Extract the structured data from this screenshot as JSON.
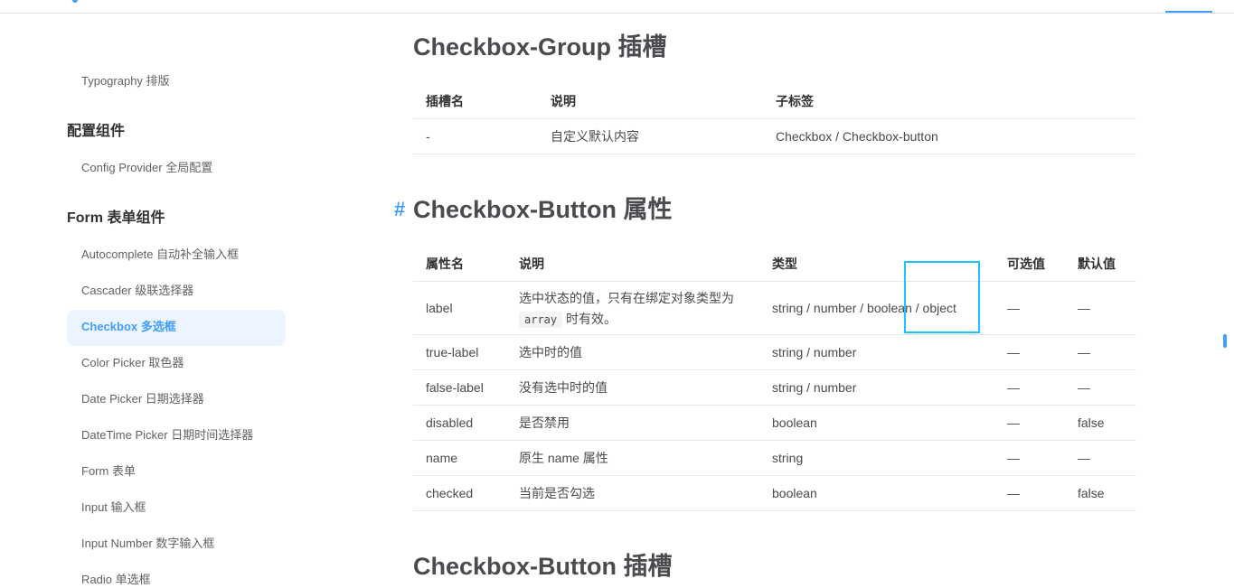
{
  "sidebar": {
    "items": [
      {
        "label": "Typography 排版"
      },
      {
        "group": "配置组件"
      },
      {
        "label": "Config Provider 全局配置"
      },
      {
        "group": "Form 表单组件"
      },
      {
        "label": "Autocomplete 自动补全输入框"
      },
      {
        "label": "Cascader 级联选择器"
      },
      {
        "label": "Checkbox 多选框",
        "active": true
      },
      {
        "label": "Color Picker 取色器"
      },
      {
        "label": "Date Picker 日期选择器"
      },
      {
        "label": "DateTime Picker 日期时间选择器"
      },
      {
        "label": "Form 表单"
      },
      {
        "label": "Input 输入框"
      },
      {
        "label": "Input Number 数字输入框"
      },
      {
        "label": "Radio 单选框"
      }
    ],
    "accent_color": "#409eff",
    "active_bg": "#ecf5ff"
  },
  "main": {
    "sections": [
      {
        "title": "Checkbox-Group 插槽",
        "headers": [
          "插槽名",
          "说明",
          "子标签"
        ],
        "rows": [
          [
            "-",
            "自定义默认内容",
            "Checkbox / Checkbox-button"
          ]
        ]
      },
      {
        "anchor": "#",
        "title": "Checkbox-Button 属性",
        "headers": [
          "属性名",
          "说明",
          "类型",
          "可选值",
          "默认值"
        ],
        "rows": [
          {
            "name": "label",
            "desc_line1": "选中状态的值，只有在绑定对象类型为",
            "desc_code": "array",
            "desc_line2": "时有效。",
            "type": "string / number / boolean / object",
            "options": "—",
            "default": "—"
          },
          {
            "name": "true-label",
            "desc": "选中时的值",
            "type": "string / number",
            "options": "—",
            "default": "—"
          },
          {
            "name": "false-label",
            "desc": "没有选中时的值",
            "type": "string / number",
            "options": "—",
            "default": "—"
          },
          {
            "name": "disabled",
            "desc": "是否禁用",
            "type": "boolean",
            "options": "—",
            "default": "false"
          },
          {
            "name": "name",
            "desc": "原生 name 属性",
            "type": "string",
            "options": "—",
            "default": "—"
          },
          {
            "name": "checked",
            "desc": "当前是否勾选",
            "type": "boolean",
            "options": "—",
            "default": "false"
          }
        ]
      },
      {
        "title": "Checkbox-Button 插槽"
      }
    ]
  }
}
